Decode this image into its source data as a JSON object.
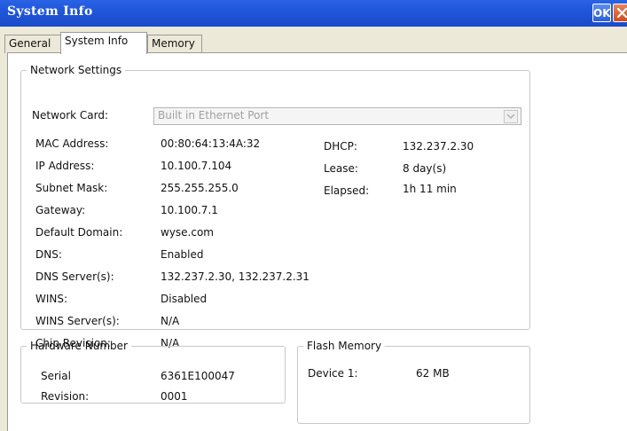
{
  "window": {
    "title": "System Info",
    "ok_label": "OK"
  },
  "tabs": [
    "General",
    "System Info",
    "Memory"
  ],
  "network": {
    "legend": "Network Settings",
    "card_label": "Network Card:",
    "card_value": "Built in Ethernet Port",
    "rows": [
      {
        "label": "MAC Address:",
        "value": "00:80:64:13:4A:32"
      },
      {
        "label": "IP Address:",
        "value": "10.100.7.104"
      },
      {
        "label": "Subnet Mask:",
        "value": "255.255.255.0"
      },
      {
        "label": "Gateway:",
        "value": "10.100.7.1"
      },
      {
        "label": "Default Domain:",
        "value": "wyse.com"
      },
      {
        "label": "DNS:",
        "value": "Enabled"
      },
      {
        "label": "DNS Server(s):",
        "value": "132.237.2.30, 132.237.2.31"
      },
      {
        "label": "WINS:",
        "value": "Disabled"
      },
      {
        "label": "WINS Server(s):",
        "value": "N/A"
      },
      {
        "label": "Chip Revision:",
        "value": "N/A"
      }
    ],
    "dhcp": [
      {
        "label": "DHCP:",
        "value": "132.237.2.30"
      },
      {
        "label": "Lease:",
        "value": "8 day(s)"
      },
      {
        "label": "Elapsed:",
        "value": "1h 11 min"
      }
    ]
  },
  "hardware": {
    "legend": "Hardware Number",
    "rows": [
      {
        "label": "Serial",
        "value": "6361E100047"
      },
      {
        "label": "Revision:",
        "value": "0001"
      }
    ]
  },
  "flash": {
    "legend": "Flash Memory",
    "device_label": "Device 1:",
    "device_value": "62 MB"
  }
}
